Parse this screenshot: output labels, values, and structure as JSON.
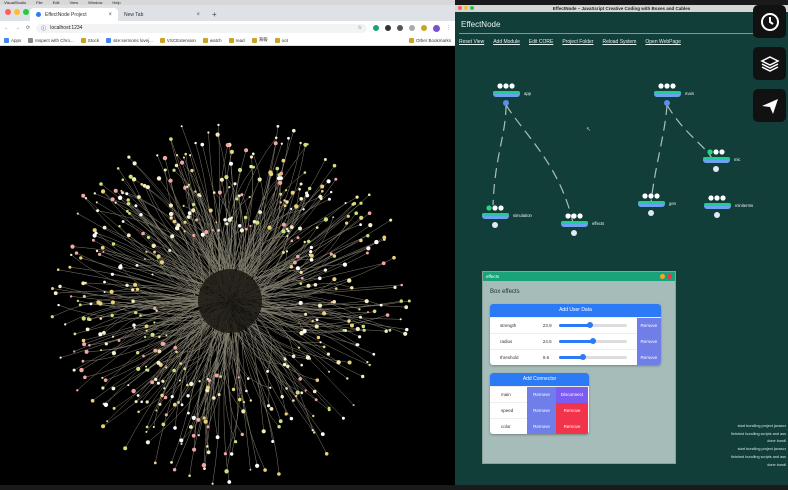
{
  "mac_menu": [
    "VisualStudio",
    "File",
    "Edit",
    "View",
    "Window",
    "Help"
  ],
  "chrome": {
    "tabs": [
      {
        "label": "EffectNode Project",
        "active": true
      },
      {
        "label": "New Tab",
        "active": false
      }
    ],
    "new_tab": "+",
    "url": "localhost:1234",
    "bookmarks": [
      "Apps",
      "Inspect with Chro...",
      "Stock",
      "site:sermons lovej...",
      "VSCExtension",
      "watch",
      "read",
      "海報",
      "oot"
    ],
    "other_bookmarks": "Other Bookmarks",
    "colors": {
      "tabbar": "#dee1e6",
      "page": "#000000"
    }
  },
  "effectnode": {
    "window_title": "EffectNode – JavaScript Creative Coding with Boxes and Cables",
    "app_name": "EffectNode",
    "menu": [
      "Reset View",
      "Add Module",
      "Edit CORE",
      "Project Folder",
      "Reload System",
      "Open WebPage"
    ],
    "nodes": [
      {
        "id": "app",
        "label": "app"
      },
      {
        "id": "main",
        "label": "main"
      },
      {
        "id": "mic",
        "label": "mic"
      },
      {
        "id": "simulation",
        "label": "simulation"
      },
      {
        "id": "effects",
        "label": "effects"
      },
      {
        "id": "gen",
        "label": "gen"
      },
      {
        "id": "miniterms",
        "label": "miniterms"
      }
    ],
    "colors": {
      "bg": "#123e3a",
      "accent": "#1aa37a",
      "button_blue": "#2c7af6",
      "remove": "#6f7ee8",
      "danger": "#f2344a",
      "node": "#7da4f5"
    }
  },
  "panel": {
    "title": "effects",
    "box_label": "Box effects",
    "add_user_data": "Add User Data",
    "params": [
      {
        "name": "strength",
        "value": "23.9",
        "level": 0.45
      },
      {
        "name": "radius",
        "value": "24.5",
        "level": 0.5
      },
      {
        "name": "threshold",
        "value": "9.6",
        "level": 0.35
      }
    ],
    "remove_label": "Remove",
    "add_connector": "Add Connector",
    "connectors": [
      {
        "name": "main",
        "remove": "Remove",
        "action": "Disconnect",
        "color": "#7d5cf0"
      },
      {
        "name": "speed",
        "remove": "Remove",
        "action": "Remove",
        "color": "#f2344a"
      },
      {
        "name": "color",
        "remove": "Remove",
        "action": "Remove",
        "color": "#f2344a"
      }
    ]
  },
  "sidebar_icons": [
    "clock-icon",
    "layers-icon",
    "send-icon"
  ],
  "log_lines": [
    "start bundling project javascr",
    "finished bundling scripts and ass",
    "done bundl",
    "start bundling project javascr",
    "finished bundling scripts and ass",
    "done bundl"
  ]
}
